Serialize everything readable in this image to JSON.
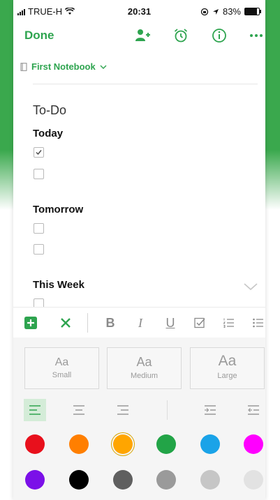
{
  "status": {
    "carrier": "TRUE-H",
    "time": "20:31",
    "battery": "83%",
    "battery_level": 0.83
  },
  "nav": {
    "done_label": "Done",
    "icons": [
      "add-person-icon",
      "reminder-icon",
      "info-icon",
      "more-icon"
    ]
  },
  "notebook": {
    "name": "First Notebook"
  },
  "note": {
    "title": "To-Do",
    "sections": [
      {
        "heading": "Today",
        "items": [
          {
            "checked": true
          },
          {
            "checked": false
          }
        ]
      },
      {
        "heading": "Tomorrow",
        "items": [
          {
            "checked": false
          },
          {
            "checked": false
          }
        ]
      },
      {
        "heading": "This Week",
        "items": [
          {
            "checked": false
          }
        ]
      }
    ]
  },
  "toolbar": {
    "bold": "B",
    "italic": "I",
    "underline": "U",
    "icons": [
      "add-icon",
      "close-icon",
      "checkbox-icon",
      "numbered-list-icon",
      "bulleted-list-icon"
    ]
  },
  "text_sizes": [
    {
      "aa": "Aa",
      "label": "Small",
      "active": true
    },
    {
      "aa": "Aa",
      "label": "Medium",
      "active": false
    },
    {
      "aa": "Aa",
      "label": "Large",
      "active": false
    }
  ],
  "alignment": {
    "selected": "left",
    "options": [
      "left",
      "center",
      "right",
      "indent",
      "outdent"
    ]
  },
  "colors": {
    "accent": "#2ea44f",
    "selected": "#ffa500",
    "swatches": [
      "#e8101c",
      "#ff7f00",
      "#ffa500",
      "#22a447",
      "#1aa3e8",
      "#ff00ff",
      "#7b10e8",
      "#000000",
      "#5f5f5f",
      "#9a9a9a",
      "#c6c6c6",
      "#e2e2e2"
    ]
  }
}
